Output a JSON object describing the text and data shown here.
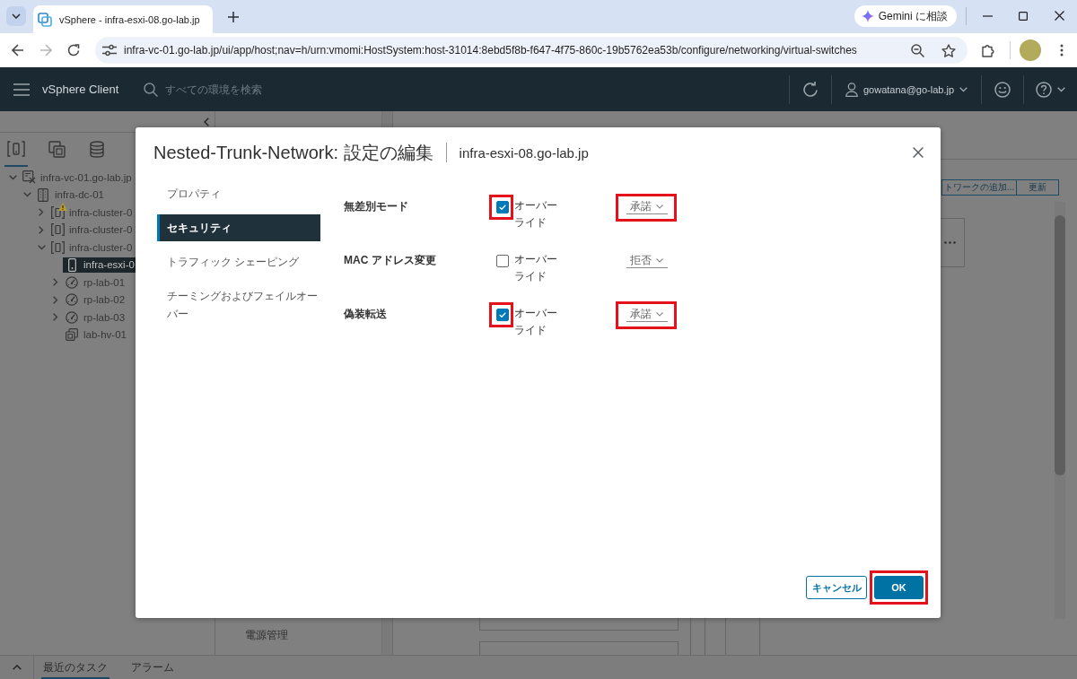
{
  "browser": {
    "tabs": [
      {
        "title": "vSphere - infra-esxi-08.go-lab.jp",
        "selected": true
      }
    ],
    "gemini_button": "Gemini に相談",
    "nav_buttons": [
      {
        "kind": "back",
        "disabled": false
      },
      {
        "kind": "forward",
        "disabled": true
      },
      {
        "kind": "reload",
        "disabled": false
      }
    ],
    "address": "infra-vc-01.go-lab.jp/ui/app/host;nav=h/urn:vmomi:HostSystem:host-31014:8ebd5f8b-f647-4f75-860c-19b5762ea53b/configure/networking/virtual-switches"
  },
  "app_header": {
    "title": "vSphere Client",
    "search": {
      "placeholder": "すべての環境を検索"
    },
    "user": "gowatana@go-lab.jp"
  },
  "inventory_tabs": [
    {
      "kind": "hosts",
      "selected": true
    },
    {
      "kind": "vms",
      "selected": false
    },
    {
      "kind": "storage",
      "selected": false
    }
  ],
  "tree": [
    {
      "label": "infra-vc-01.go-lab.jp",
      "kind": "vcenter",
      "expanded": true,
      "selected": false,
      "children": [
        {
          "label": "infra-dc-01",
          "kind": "datacenter",
          "expanded": true,
          "selected": false,
          "children": [
            {
              "label": "infra-cluster-0",
              "kind": "cluster",
              "expanded": false,
              "selected": false,
              "warning": true
            },
            {
              "label": "infra-cluster-0",
              "kind": "cluster",
              "expanded": false,
              "selected": false,
              "warning": false
            },
            {
              "label": "infra-cluster-0",
              "kind": "cluster",
              "expanded": true,
              "selected": false,
              "warning": false,
              "children": [
                {
                  "label": "infra-esxi-0",
                  "kind": "host",
                  "selected": true
                },
                {
                  "label": "rp-lab-01",
                  "kind": "resource-pool",
                  "expanded": false,
                  "selected": false
                },
                {
                  "label": "rp-lab-02",
                  "kind": "resource-pool",
                  "expanded": false,
                  "selected": false
                },
                {
                  "label": "rp-lab-03",
                  "kind": "resource-pool",
                  "expanded": false,
                  "selected": false
                },
                {
                  "label": "lab-hv-01",
                  "kind": "vapp",
                  "selected": false
                }
              ]
            }
          ]
        }
      ]
    }
  ],
  "side_menu": [
    "電源管理"
  ],
  "toolbar_buttons": [
    "トワークの追加...",
    "更新"
  ],
  "bottom_tabs": [
    {
      "label": "最近のタスク",
      "selected": true
    },
    {
      "label": "アラーム",
      "selected": false
    }
  ],
  "dialog": {
    "title": "Nested-Trunk-Network: 設定の編集",
    "subtitle": "infra-esxi-08.go-lab.jp",
    "nav": [
      {
        "label": "プロパティ",
        "selected": false
      },
      {
        "label": "セキュリティ",
        "selected": true
      },
      {
        "label": "トラフィック シェーピング",
        "selected": false
      },
      {
        "label": "チーミングおよびフェイルオーバー",
        "selected": false
      }
    ],
    "settings": [
      {
        "label": "無差別モード",
        "override": {
          "label": "オーバーライド",
          "checked": true,
          "highlighted": true
        },
        "policy": {
          "value": "承諾",
          "highlighted": true
        }
      },
      {
        "label": "MAC アドレス変更",
        "override": {
          "label": "オーバーライド",
          "checked": false,
          "highlighted": false
        },
        "policy": {
          "value": "拒否",
          "highlighted": false
        }
      },
      {
        "label": "偽装転送",
        "override": {
          "label": "オーバーライド",
          "checked": true,
          "highlighted": true
        },
        "policy": {
          "value": "承諾",
          "highlighted": true
        }
      }
    ],
    "buttons": [
      {
        "label": "キャンセル",
        "kind": "secondary",
        "highlighted": false
      },
      {
        "label": "OK",
        "kind": "primary",
        "highlighted": true
      }
    ]
  }
}
